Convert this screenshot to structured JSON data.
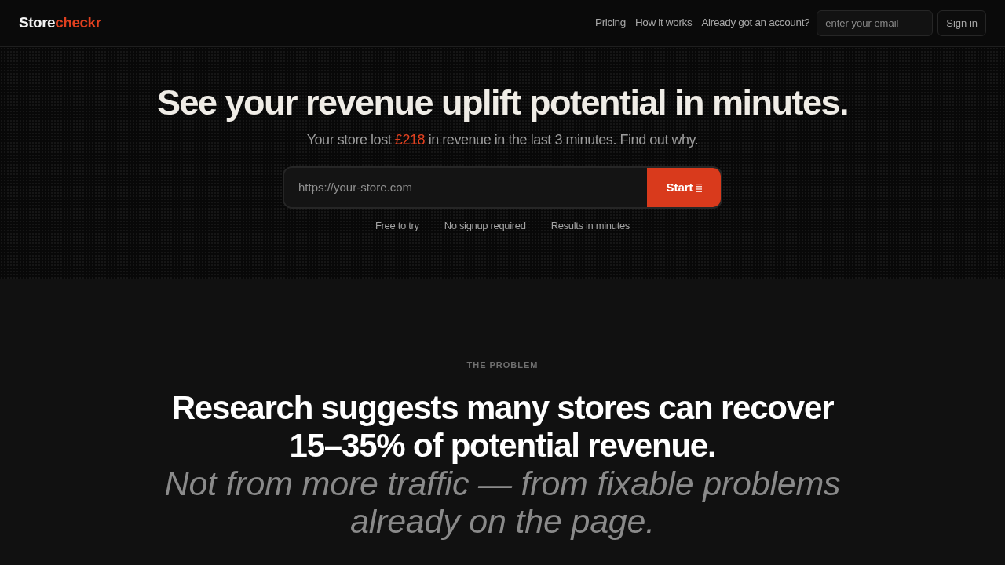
{
  "header": {
    "logo": {
      "primary": "Store",
      "accent": "checkr"
    },
    "nav_links": [
      "Pricing",
      "How it works"
    ],
    "account_prompt": "Already got an account?",
    "email_field": {
      "placeholder": "enter your email"
    },
    "sign_in_button": "Sign in"
  },
  "hero": {
    "title": "See your revenue uplift potential in minutes.",
    "subtitle": {
      "before": "Your store lost",
      "amount": "£218",
      "after": "in revenue in the last 3 minutes. Find out why."
    },
    "url_field": {
      "placeholder": "https://your-store.com"
    },
    "start_button": "Start",
    "features": [
      "Free to try",
      "No signup required",
      "Results in minutes"
    ]
  },
  "problem": {
    "eyebrow": "THE PROBLEM",
    "heading": "Research suggests many stores can recover 15–35% of potential revenue.",
    "subheading": "Not from more traffic — from fixable problems already on the page."
  }
}
